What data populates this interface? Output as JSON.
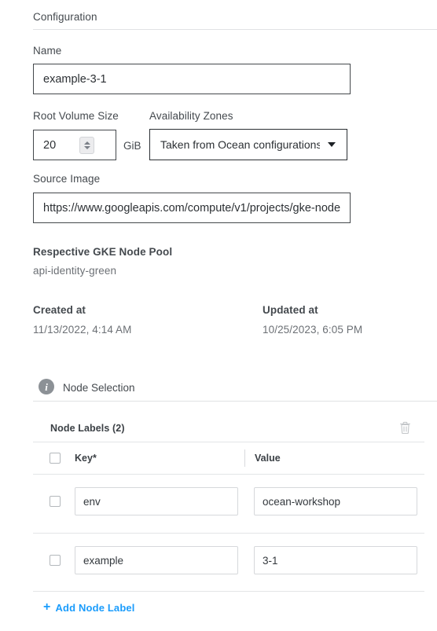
{
  "configuration": {
    "section_title": "Configuration",
    "name": {
      "label": "Name",
      "value": "example-3-1"
    },
    "root_volume_size": {
      "label": "Root Volume Size",
      "value": "20",
      "unit": "GiB"
    },
    "availability_zones": {
      "label": "Availability Zones",
      "selected": "Taken from Ocean configurations"
    },
    "source_image": {
      "label": "Source Image",
      "value": "https://www.googleapis.com/compute/v1/projects/gke-node"
    },
    "gke_node_pool": {
      "label": "Respective GKE Node Pool",
      "value": "api-identity-green"
    },
    "created_at": {
      "label": "Created at",
      "value": "11/13/2022, 4:14 AM"
    },
    "updated_at": {
      "label": "Updated at",
      "value": "10/25/2023, 6:05 PM"
    }
  },
  "node_selection": {
    "title": "Node Selection",
    "info_icon": "info-icon",
    "table": {
      "title": "Node Labels",
      "count": "(2)",
      "delete_icon": "trash-icon",
      "columns": [
        {
          "label": "Key",
          "required": "*"
        },
        {
          "label": "Value",
          "required": ""
        }
      ],
      "rows": [
        {
          "key": "env",
          "value": "ocean-workshop"
        },
        {
          "key": "example",
          "value": "3-1"
        }
      ],
      "add_label": "Add Node Label",
      "add_icon": "plus-icon"
    }
  },
  "colors": {
    "accent_blue": "#1a9cfc",
    "text_primary": "#44494e",
    "text_muted": "#6c7075",
    "border_strong": "#44484c",
    "border_light": "#d6d8db",
    "divider": "#e0e2e4",
    "info_gray": "#8c9196"
  }
}
